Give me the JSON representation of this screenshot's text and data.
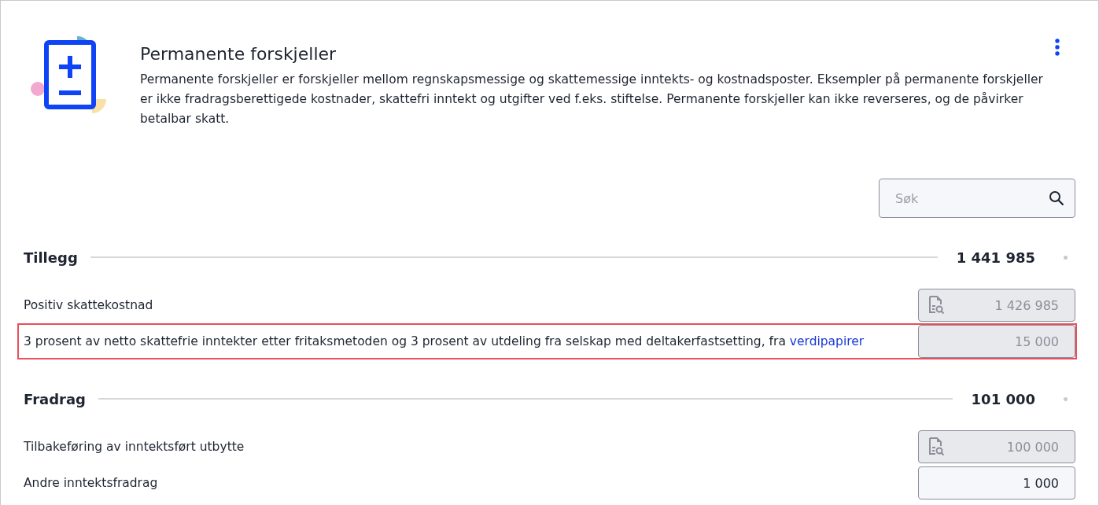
{
  "header": {
    "title": "Permanente forskjeller",
    "description": "Permanente forskjeller er forskjeller mellom regnskapsmessige og skattemessige inntekts- og kostnadsposter. Eksempler på permanente forskjeller er ikke fradragsberettigede kostnader, skattefri inntekt og utgifter ved f.eks. stiftelse. Permanente forskjeller kan ikke reverseres, og de påvirker betalbar skatt."
  },
  "search": {
    "placeholder": "Søk"
  },
  "sections": [
    {
      "title": "Tillegg",
      "total": "1 441 985",
      "rows": [
        {
          "label": "Positiv skattekostnad",
          "value": "1 426 985",
          "disabled": true,
          "doc_icon": true,
          "selected": false
        },
        {
          "label": "3 prosent av netto skattefrie inntekter etter fritaksmetoden og 3 prosent av utdeling fra selskap med deltakerfastsetting, fra",
          "link": "verdipapirer",
          "value": "15 000",
          "disabled": true,
          "doc_icon": false,
          "selected": true
        }
      ]
    },
    {
      "title": "Fradrag",
      "total": "101 000",
      "rows": [
        {
          "label": "Tilbakeføring av inntektsført utbytte",
          "value": "100 000",
          "disabled": true,
          "doc_icon": true,
          "selected": false
        },
        {
          "label": "Andre inntektsfradrag",
          "value": "1 000",
          "disabled": false,
          "doc_icon": false,
          "selected": false
        }
      ]
    }
  ]
}
